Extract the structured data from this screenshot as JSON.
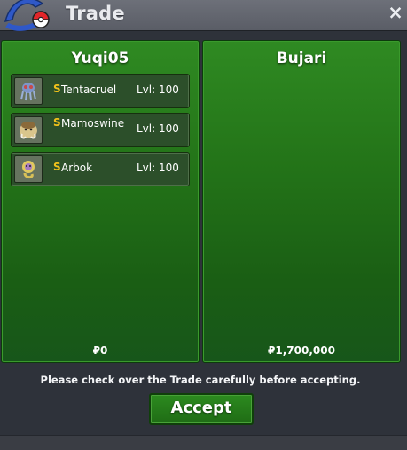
{
  "window": {
    "title": "Trade",
    "close_glyph": "×"
  },
  "left_panel": {
    "player": "Yuqi05",
    "money": "₽0",
    "pokemon": [
      {
        "shiny": "S",
        "name": "Tentacruel",
        "level": "Lvl: 100",
        "icon": "tentacruel-sprite-icon"
      },
      {
        "shiny": "S",
        "name": "Mamoswine",
        "level": "Lvl: 100",
        "icon": "mamoswine-sprite-icon"
      },
      {
        "shiny": "S",
        "name": "Arbok",
        "level": "Lvl: 100",
        "icon": "arbok-sprite-icon"
      }
    ]
  },
  "right_panel": {
    "player": "Bujari",
    "money": "₽1,700,000",
    "pokemon": []
  },
  "notice": "Please check over the Trade carefully before accepting.",
  "accept_label": "Accept",
  "colors": {
    "panel_green": "#237318",
    "shiny": "#f2c21b",
    "background": "#2e323a"
  }
}
